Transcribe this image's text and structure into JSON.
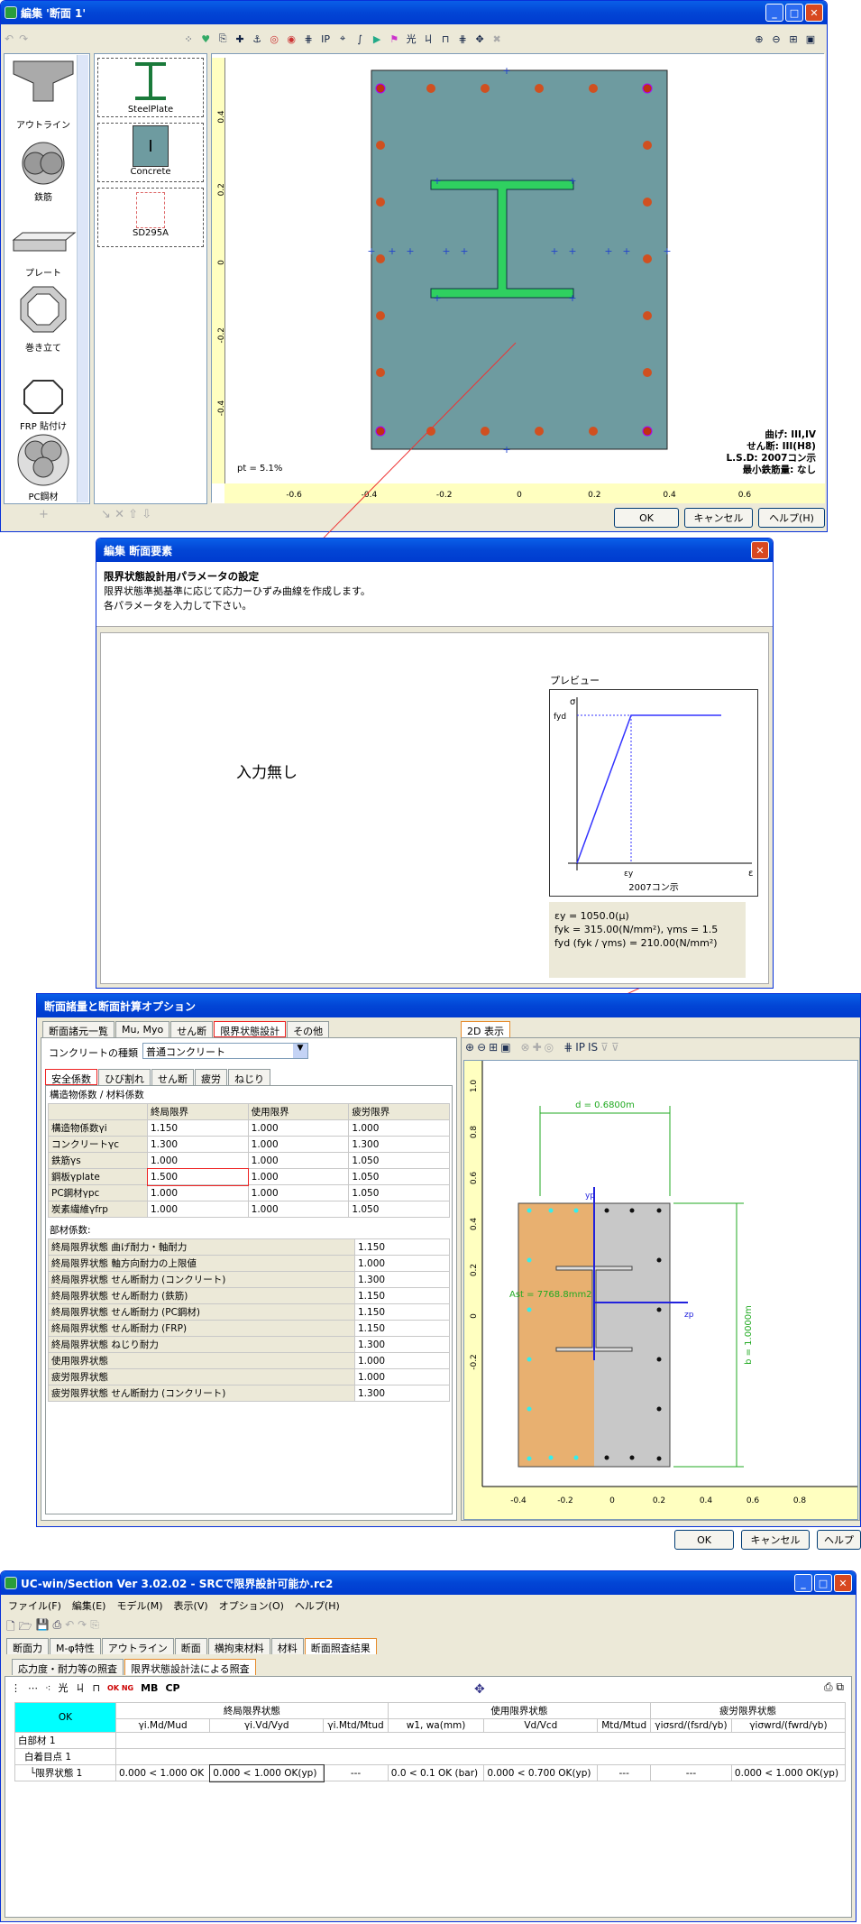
{
  "w1": {
    "title": "編集 '断面 1'",
    "palette": [
      "アウトライン",
      "鉄筋",
      "プレート",
      "巻き立て",
      "FRP 貼付け",
      "PC鋼材"
    ],
    "materials": [
      "SteelPlate",
      "Concrete",
      "SD295A"
    ],
    "ratio": "pt = 5.1%",
    "info": [
      "曲げ: III,IV",
      "せん断: III(H8)",
      "L.S.D: 2007コン示",
      "最小鉄筋量: なし"
    ],
    "yticks": [
      "0.4",
      "0.2",
      "0",
      "-0.2",
      "-0.4"
    ],
    "xticks": [
      "-0.6",
      "-0.4",
      "-0.2",
      "0",
      "0.2",
      "0.4",
      "0.6"
    ],
    "ok": "OK",
    "cancel": "キャンセル",
    "help": "ヘルプ(H)"
  },
  "w2": {
    "title": "編集 断面要素",
    "heading": "限界状態設計用パラメータの設定",
    "desc1": "限界状態準拠基準に応じて応力ーひずみ曲線を作成します。",
    "desc2": "各パラメータを入力して下さい。",
    "noinput": "入力無し",
    "preview": "プレビュー",
    "sigma": "σ",
    "fyd": "fyd",
    "ey": "εy",
    "eps": "ε",
    "std": "2007コン示",
    "p1": "εy = 1050.0(μ)",
    "p2": "fyk = 315.00(N/mm²), γms = 1.5",
    "p3": "fyd (fyk / γms) = 210.00(N/mm²)"
  },
  "w3": {
    "title": "断面諸量と断面計算オプション",
    "tabs": [
      "断面諸元一覧",
      "Mu, Myo",
      "せん断",
      "限界状態設計",
      "その他"
    ],
    "conc_label": "コンクリートの種類",
    "conc_value": "普通コンクリート",
    "subtabs": [
      "安全係数",
      "ひび割れ",
      "せん断",
      "疲労",
      "ねじり"
    ],
    "sec1": "構造物係数 / 材料係数",
    "cols": [
      "",
      "終局限界",
      "使用限界",
      "疲労限界"
    ],
    "rows1": [
      [
        "構造物係数γi",
        "1.150",
        "1.000",
        "1.000"
      ],
      [
        "コンクリートγc",
        "1.300",
        "1.000",
        "1.300"
      ],
      [
        "鉄筋γs",
        "1.000",
        "1.000",
        "1.050"
      ],
      [
        "鋼板γplate",
        "1.500",
        "1.000",
        "1.050"
      ],
      [
        "PC鋼材γpc",
        "1.000",
        "1.000",
        "1.050"
      ],
      [
        "炭素繊維γfrp",
        "1.000",
        "1.000",
        "1.050"
      ]
    ],
    "sec2": "部材係数:",
    "rows2": [
      [
        "終局限界状態 曲げ耐力・軸耐力",
        "1.150"
      ],
      [
        "終局限界状態 軸方向耐力の上限値",
        "1.000"
      ],
      [
        "終局限界状態 せん断耐力 (コンクリート)",
        "1.300"
      ],
      [
        "終局限界状態 せん断耐力 (鉄筋)",
        "1.150"
      ],
      [
        "終局限界状態 せん断耐力 (PC鋼材)",
        "1.150"
      ],
      [
        "終局限界状態 せん断耐力 (FRP)",
        "1.150"
      ],
      [
        "終局限界状態 ねじり耐力",
        "1.300"
      ],
      [
        "使用限界状態",
        "1.000"
      ],
      [
        "疲労限界状態",
        "1.000"
      ],
      [
        "疲労限界状態 せん断耐力 (コンクリート)",
        "1.300"
      ]
    ],
    "tab2d": "2D 表示",
    "dim_d": "d = 0.6800m",
    "dim_b": "b = 1.0000m",
    "ast": "Ast = 7768.8mm2",
    "yp": "yp",
    "zp": "zp",
    "yticks": [
      "1.0",
      "0.8",
      "0.6",
      "0.4",
      "0.2",
      "0",
      "-0.2"
    ],
    "xticks": [
      "-0.4",
      "-0.2",
      "0",
      "0.2",
      "0.4",
      "0.6",
      "0.8"
    ],
    "ok": "OK",
    "cancel": "キャンセル",
    "help": "ヘルプ"
  },
  "w4": {
    "title": "UC-win/Section Ver 3.02.02 - SRCで限界設計可能か.rc2",
    "menu": [
      "ファイル(F)",
      "編集(E)",
      "モデル(M)",
      "表示(V)",
      "オプション(O)",
      "ヘルプ(H)"
    ],
    "tabs": [
      "断面力",
      "M-φ特性",
      "アウトライン",
      "断面",
      "横拘束材料",
      "材料",
      "断面照査結果"
    ],
    "subtabs": [
      "応力度・耐力等の照査",
      "限界状態設計法による照査"
    ],
    "tb": [
      "MB",
      "CP"
    ],
    "ok": "OK",
    "groups": [
      "終局限界状態",
      "使用限界状態",
      "疲労限界状態"
    ],
    "cols": [
      "γi.Md/Mud",
      "γi.Vd/Vyd",
      "γi.Mtd/Mtud",
      "w1, wa(mm)",
      "Vd/Vcd",
      "Mtd/Mtud",
      "γiσsrd/(fsrd/γb)",
      "γiσwrd/(fwrd/γb)"
    ],
    "tree": [
      "白部材 1",
      "白着目点 1",
      "└限界状態 1"
    ],
    "vals": [
      "0.000 < 1.000 OK",
      "0.000 < 1.000 OK(yp)",
      "---",
      "0.0 < 0.1 OK (bar)",
      "0.000 < 0.700 OK(yp)",
      "---",
      "---",
      "0.000 < 1.000 OK(yp)"
    ]
  }
}
